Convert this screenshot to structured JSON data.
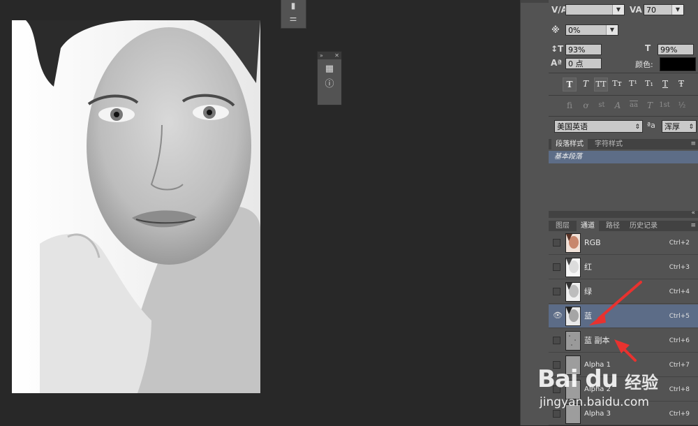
{
  "character": {
    "kerning_value": "",
    "tracking_value": "70",
    "tsume_value": "0%",
    "vertical_scale": "93%",
    "horizontal_scale": "99%",
    "baseline_shift": "0 点",
    "color_label": "颜色:",
    "color_value": "#000000",
    "language": "美国英语",
    "aa_label": "ªa",
    "antialias": "浑厚"
  },
  "type_style_buttons": [
    "T",
    "T",
    "TT",
    "Tт",
    "T¹",
    "T₁",
    "T",
    "Ŧ"
  ],
  "opentype_buttons": [
    "ﬁ",
    "ơ",
    "st",
    "A",
    "aa",
    "T",
    "1st",
    "½"
  ],
  "styles_panel": {
    "tabs": [
      "段落样式",
      "字符样式"
    ],
    "items": [
      "基本段落"
    ]
  },
  "layers_panel": {
    "tabs": [
      "图层",
      "通道",
      "路径",
      "历史记录"
    ],
    "channels": [
      {
        "name": "RGB",
        "shortcut": "Ctrl+2",
        "visible": false,
        "selected": false
      },
      {
        "name": "红",
        "shortcut": "Ctrl+3",
        "visible": false,
        "selected": false
      },
      {
        "name": "绿",
        "shortcut": "Ctrl+4",
        "visible": false,
        "selected": false
      },
      {
        "name": "蓝",
        "shortcut": "Ctrl+5",
        "visible": true,
        "selected": true
      },
      {
        "name": "蓝 副本",
        "shortcut": "Ctrl+6",
        "visible": false,
        "selected": false
      },
      {
        "name": "Alpha 1",
        "shortcut": "Ctrl+7",
        "visible": false,
        "selected": false
      },
      {
        "name": "Alpha 2",
        "shortcut": "Ctrl+8",
        "visible": false,
        "selected": false
      },
      {
        "name": "Alpha 3",
        "shortcut": "Ctrl+9",
        "visible": false,
        "selected": false
      }
    ]
  },
  "watermark": {
    "brand": "Bai du",
    "product": "经验",
    "url": "jingyan.baidu.com"
  },
  "colors": {
    "panel_bg": "#535353",
    "canvas_bg": "#282828",
    "selection": "#5c6c87",
    "annotation_arrow": "#e8322f"
  }
}
